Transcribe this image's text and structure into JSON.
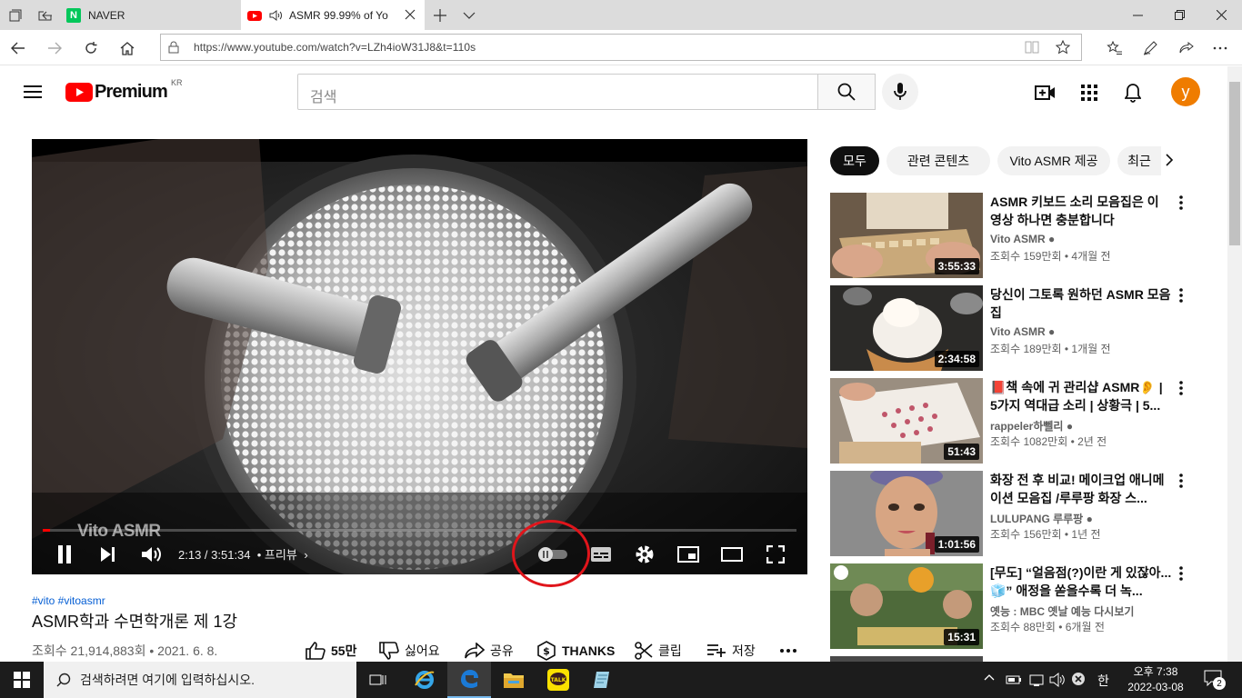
{
  "browser": {
    "tabs": [
      {
        "title": "NAVER",
        "active": false
      },
      {
        "title": "ASMR 99.99% of Yo",
        "active": true
      }
    ],
    "url": "https://www.youtube.com/watch?v=LZh4ioW31J8&t=110s"
  },
  "youtube": {
    "logo_text": "Premium",
    "region": "KR",
    "search_placeholder": "검색",
    "avatar_letter": "y"
  },
  "player": {
    "watermark": "Vito ASMR",
    "time": "2:13 / 3:51:34",
    "chapter": "• 프리뷰",
    "progress": 0.0096
  },
  "video": {
    "tags": "#vito #vitoasmr",
    "title": "ASMR학과 수면학개론 제 1강",
    "views": "조회수 21,914,883회 • 2021. 6. 8.",
    "likes": "55만",
    "dislike": "싫어요",
    "share": "공유",
    "thanks": "THANKS",
    "clip": "클립",
    "save": "저장"
  },
  "chips": [
    "모두",
    "관련 콘텐츠",
    "Vito ASMR 제공",
    "최근"
  ],
  "recommendations": [
    {
      "title": "ASMR 키보드 소리 모음집은 이 영상 하나면 충분합니다",
      "channel": "Vito ASMR",
      "verified": true,
      "meta": "조회수 159만회 • 4개월 전",
      "duration": "3:55:33"
    },
    {
      "title": "당신이 그토록 원하던 ASMR 모음집",
      "channel": "Vito ASMR",
      "verified": true,
      "meta": "조회수 189만회 • 1개월 전",
      "duration": "2:34:58"
    },
    {
      "title": "📕책 속에 귀 관리샵 ASMR👂 | 5가지 역대급 소리 | 상황극 | 5...",
      "channel": "rappeler하뻴리",
      "verified": true,
      "meta": "조회수 1082만회 • 2년 전",
      "duration": "51:43"
    },
    {
      "title": "화장 전 후 비교! 메이크업 애니메이션 모음집 /루루팡 화장 스...",
      "channel": "LULUPANG 루루팡",
      "verified": true,
      "meta": "조회수 156만회 • 1년 전",
      "duration": "1:01:56"
    },
    {
      "title": "[무도] “얼음점(?)이란 게 있잖아...🧊” 애정을 쏟을수록 더 녹...",
      "channel": "옛능 : MBC 옛날 예능 다시보기",
      "verified": false,
      "meta": "조회수 88만회 • 6개월 전",
      "duration": "15:31"
    }
  ],
  "taskbar": {
    "search_placeholder": "검색하려면 여기에 입력하십시오.",
    "time": "오후 7:38",
    "date": "2022-03-08",
    "ime": "한",
    "notifications": "2"
  }
}
